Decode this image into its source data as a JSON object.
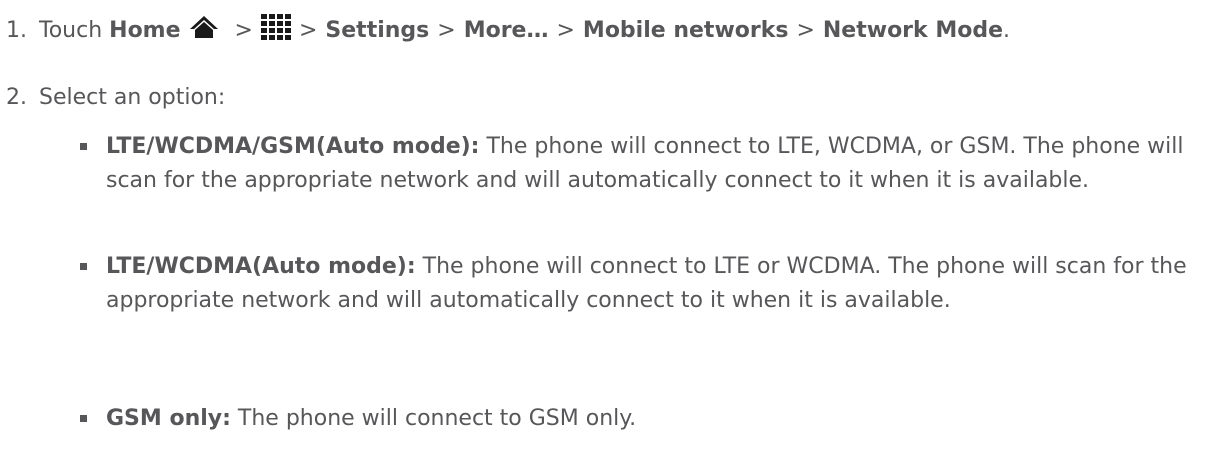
{
  "step1": {
    "number": "1.",
    "touch": "Touch",
    "home": "Home",
    "sep": ">",
    "settings": "Settings",
    "more": "More…",
    "mobile_networks": "Mobile networks",
    "network_mode": "Network Mode",
    "end": "."
  },
  "step2": {
    "number": "2.",
    "text": "Select an option:"
  },
  "options": [
    {
      "label": "LTE/WCDMA/GSM(Auto mode):",
      "desc": " The phone will connect to LTE, WCDMA, or GSM. The phone will scan for the appropriate network and will automatically connect to it when it is available."
    },
    {
      "label": "LTE/WCDMA(Auto mode):",
      "desc": " The phone will connect to LTE or WCDMA. The phone will scan for the appropriate network and will automatically connect to it when it is available."
    },
    {
      "label": "GSM only:",
      "desc": " The phone will connect to GSM only."
    }
  ],
  "colors": {
    "text": "#57575a",
    "icon": "#1a1a1a"
  },
  "icons": {
    "home": "home-icon",
    "apps": "apps-grid-icon"
  }
}
